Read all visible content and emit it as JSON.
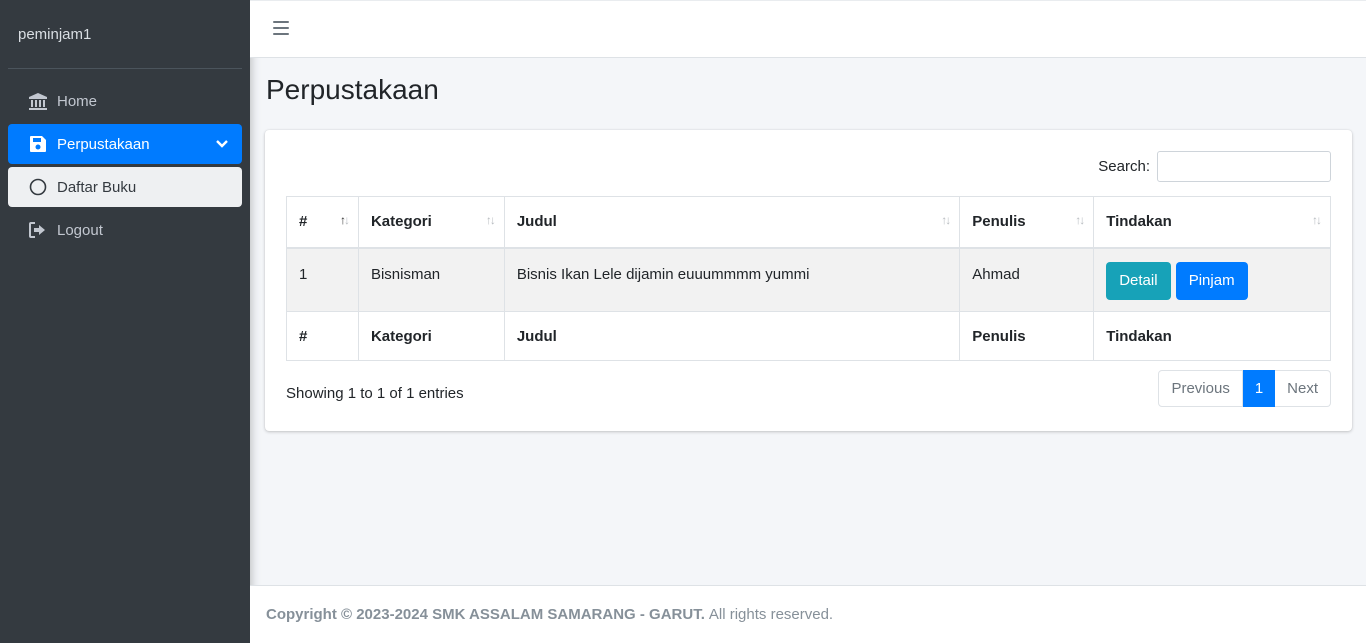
{
  "sidebar": {
    "brand": "peminjam1",
    "items": [
      {
        "label": "Home",
        "icon": "bank-icon"
      },
      {
        "label": "Perpustakaan",
        "icon": "save-icon"
      },
      {
        "label": "Daftar Buku",
        "icon": "circle-icon"
      },
      {
        "label": "Logout",
        "icon": "sign-out-icon"
      }
    ]
  },
  "page": {
    "title": "Perpustakaan"
  },
  "search": {
    "label": "Search:",
    "value": ""
  },
  "table": {
    "headers": [
      "#",
      "Kategori",
      "Judul",
      "Penulis",
      "Tindakan"
    ],
    "rows": [
      {
        "no": "1",
        "kategori": "Bisnisman",
        "judul": "Bisnis Ikan Lele dijamin euuummmm yummi",
        "penulis": "Ahmad"
      }
    ],
    "actions": {
      "detail": "Detail",
      "pinjam": "Pinjam"
    }
  },
  "info": "Showing 1 to 1 of 1 entries",
  "pagination": {
    "previous": "Previous",
    "current": "1",
    "next": "Next"
  },
  "footer": {
    "bold": "Copyright © 2023-2024 SMK ASSALAM SAMARANG - GARUT.",
    "rest": "All rights reserved."
  },
  "colors": {
    "sidebar": "#343a40",
    "primary": "#007bff",
    "info": "#17a2b8",
    "background": "#f4f6f9"
  }
}
